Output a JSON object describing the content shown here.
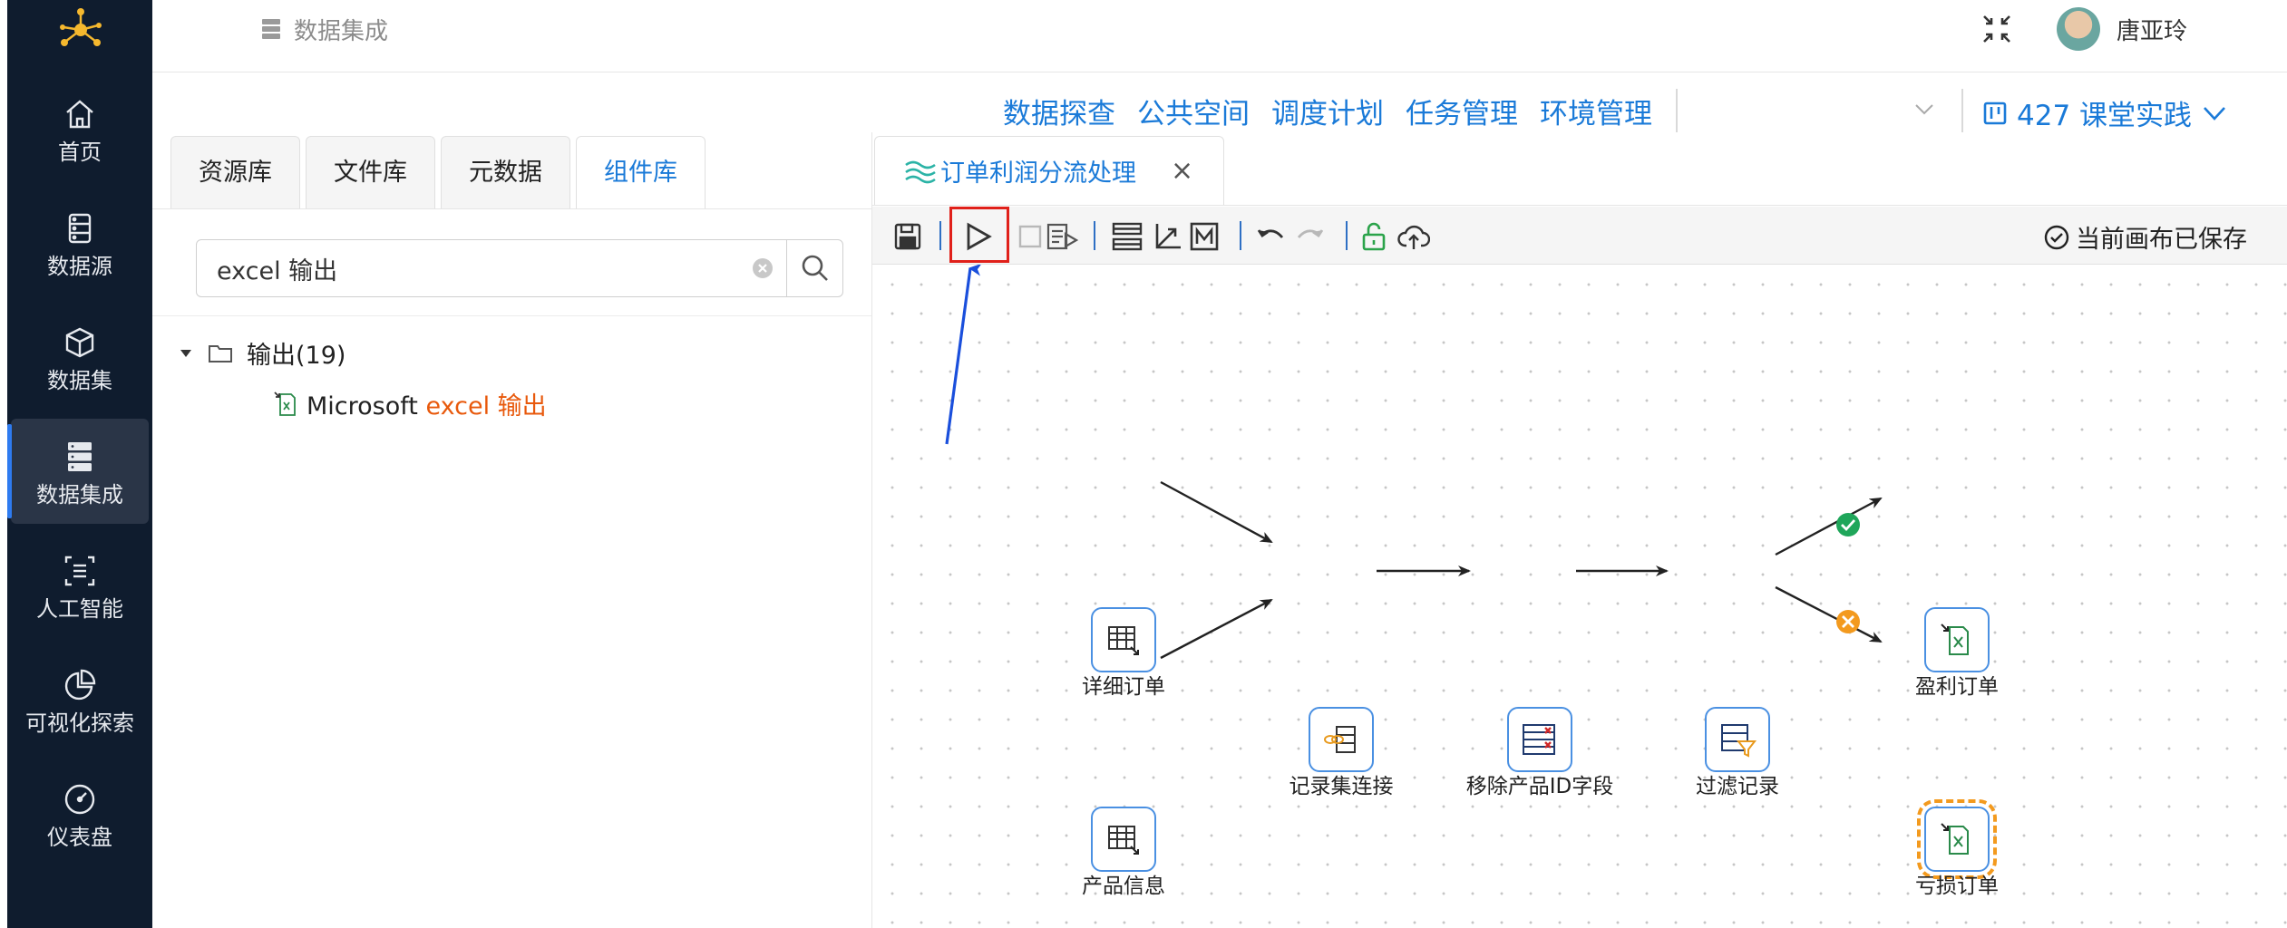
{
  "header": {
    "breadcrumb": "数据集成",
    "user_name": "唐亚玲"
  },
  "sidebar": {
    "items": [
      {
        "label": "首页",
        "icon": "home-icon"
      },
      {
        "label": "数据源",
        "icon": "database-icon"
      },
      {
        "label": "数据集",
        "icon": "cube-icon"
      },
      {
        "label": "数据集成",
        "icon": "server-stack-icon",
        "active": true
      },
      {
        "label": "人工智能",
        "icon": "ai-icon"
      },
      {
        "label": "可视化探索",
        "icon": "pie-chart-icon"
      },
      {
        "label": "仪表盘",
        "icon": "gauge-icon"
      }
    ]
  },
  "subnav": {
    "links": [
      "数据探查",
      "公共空间",
      "调度计划",
      "任务管理",
      "环境管理"
    ],
    "project": "427 课堂实践"
  },
  "library": {
    "tabs": [
      "资源库",
      "文件库",
      "元数据",
      "组件库"
    ],
    "active_tab": "组件库",
    "search_value": "excel 输出",
    "folder": "输出(19)",
    "leaf_prefix": "Microsoft ",
    "leaf_highlight": "excel 输出"
  },
  "editor": {
    "tab_title": "订单利润分流处理",
    "status": "当前画布已保存",
    "nodes": [
      {
        "id": "detail",
        "label": "详细订单",
        "icon": "table-input-icon"
      },
      {
        "id": "product",
        "label": "产品信息",
        "icon": "table-input-icon"
      },
      {
        "id": "join",
        "label": "记录集连接",
        "icon": "join-icon"
      },
      {
        "id": "remove",
        "label": "移除产品ID字段",
        "icon": "remove-fields-icon"
      },
      {
        "id": "filter",
        "label": "过滤记录",
        "icon": "filter-icon"
      },
      {
        "id": "profit",
        "label": "盈利订单",
        "icon": "excel-output-icon"
      },
      {
        "id": "loss",
        "label": "亏损订单",
        "icon": "excel-output-icon",
        "selected": true
      }
    ]
  },
  "colors": {
    "nav_bg": "#0f1c2e",
    "accent": "#1a7ad8",
    "node_border": "#4a90e2",
    "success": "#1fa65a",
    "failure": "#f39a1e",
    "highlight_box": "#e0201a",
    "annotation_arrow": "#1a4fdc"
  }
}
